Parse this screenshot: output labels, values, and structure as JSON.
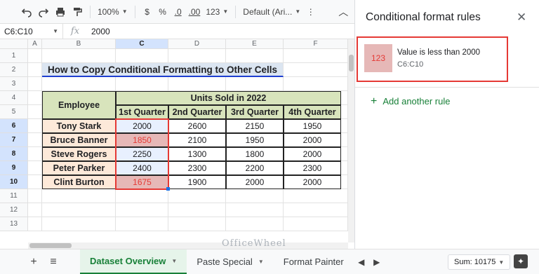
{
  "toolbar": {
    "zoom": "100%",
    "currency": "$",
    "percent": "%",
    "dec_decrease": ".0",
    "dec_increase": ".00",
    "number_format": "123",
    "font": "Default (Ari...",
    "icons": [
      "undo-icon",
      "redo-icon",
      "print-icon",
      "paint-format-icon",
      "collapse-icon"
    ]
  },
  "formula_bar": {
    "name_box": "C6:C10",
    "fx": "fx",
    "value": "2000"
  },
  "grid": {
    "columns": [
      "A",
      "B",
      "C",
      "D",
      "E",
      "F"
    ],
    "rows": [
      "1",
      "2",
      "3",
      "4",
      "5",
      "6",
      "7",
      "8",
      "9",
      "10",
      "11",
      "12",
      "13"
    ],
    "title": "How to Copy Conditional Formatting to Other Cells",
    "header_employee": "Employee",
    "header_units": "Units Sold in 2022",
    "quarters": [
      "1st Quarter",
      "2nd Quarter",
      "3rd Quarter",
      "4th Quarter"
    ],
    "data": [
      {
        "name": "Tony Stark",
        "q": [
          "2000",
          "2600",
          "2150",
          "1950"
        ],
        "cf": false
      },
      {
        "name": "Bruce Banner",
        "q": [
          "1850",
          "2100",
          "1950",
          "2000"
        ],
        "cf": true
      },
      {
        "name": "Steve Rogers",
        "q": [
          "2250",
          "1300",
          "1800",
          "2000"
        ],
        "cf": false
      },
      {
        "name": "Peter Parker",
        "q": [
          "2400",
          "2300",
          "2200",
          "2300"
        ],
        "cf": false
      },
      {
        "name": "Clint Burton",
        "q": [
          "1675",
          "1900",
          "2000",
          "2000"
        ],
        "cf": true
      }
    ]
  },
  "tabs": {
    "sheets": [
      "Dataset Overview",
      "Paste Special",
      "Format Painter"
    ],
    "active": "Dataset Overview",
    "sum": "Sum: 10175"
  },
  "panel": {
    "title": "Conditional format rules",
    "rule_swatch": "123",
    "rule_text": "Value is less than 2000",
    "rule_range": "C6:C10",
    "add_rule": "Add another rule"
  },
  "watermark": "OfficeWheel",
  "colors": {
    "accent_green": "#188038",
    "highlight_red": "#e53935",
    "cf_fill": "#e6b8b7",
    "header_fill": "#d8e4bc",
    "employee_fill": "#fde9d9"
  }
}
